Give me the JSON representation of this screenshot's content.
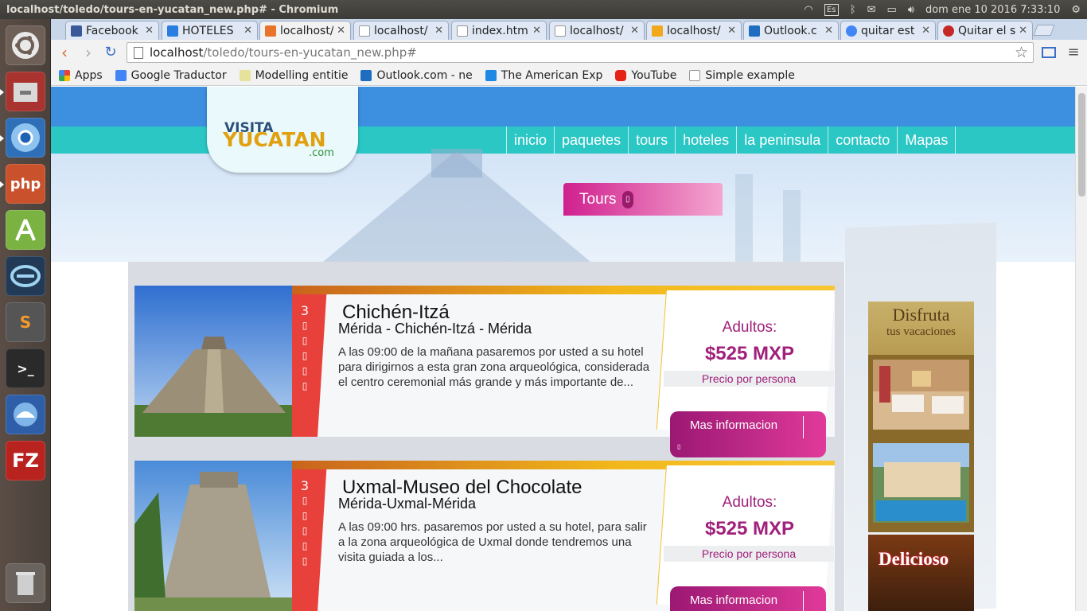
{
  "window": {
    "title": "localhost/toledo/tours-en-yucatan_new.php# - Chromium",
    "kbd_layout": "Es",
    "clock": "dom ene 10 2016  7:33:10"
  },
  "tabs": [
    {
      "label": "Facebook",
      "color": "#3b5998"
    },
    {
      "label": "HOTELES",
      "color": "#2a7de1"
    },
    {
      "label": "localhost/",
      "color": "#e8742c"
    },
    {
      "label": "localhost/",
      "color": "#bbbbbb"
    },
    {
      "label": "index.htm",
      "color": "#bbbbbb"
    },
    {
      "label": "localhost/",
      "color": "#bbbbbb"
    },
    {
      "label": "localhost/",
      "color": "#f2a81d"
    },
    {
      "label": "Outlook.c",
      "color": "#1f6dc0"
    },
    {
      "label": "quitar est",
      "color": "#4285f4"
    },
    {
      "label": "Quitar el s",
      "color": "#c62828"
    }
  ],
  "address": {
    "host": "localhost",
    "path": "/toledo/tours-en-yucatan_new.php#"
  },
  "bookmarks": [
    {
      "label": "Apps",
      "color": "#e94235"
    },
    {
      "label": "Google Traductor",
      "color": "#4285f4"
    },
    {
      "label": "Modelling entitie",
      "color": "#e7e29b"
    },
    {
      "label": "Outlook.com - ne",
      "color": "#1f6dc0"
    },
    {
      "label": "The American Exp",
      "color": "#1e88e5"
    },
    {
      "label": "YouTube",
      "color": "#e62117"
    },
    {
      "label": "Simple example",
      "color": "#dddddd"
    }
  ],
  "site": {
    "logo": {
      "line1": "VISITA",
      "line2": "YUCATAN",
      "line3": ".com"
    },
    "nav": [
      "inicio",
      "paquetes",
      "tours",
      "hoteles",
      "la peninsula",
      "contacto",
      "Mapas"
    ],
    "section_badge": "Tours",
    "badge_icon": "▯",
    "tours": [
      {
        "days": "3",
        "title": "Chichén-Itzá",
        "route": "Mérida - Chichén-Itzá - Mérida",
        "description": "A las 09:00 de la mañana pasaremos por usted a su hotel para dirigirnos a esta gran zona arqueológica, considerada el centro ceremonial más grande y más importante de...",
        "price_label": "Adultos:",
        "price": "$525 MXP",
        "per_person": "Precio por persona",
        "more": "Mas informacion"
      },
      {
        "days": "3",
        "title": "Uxmal-Museo del Chocolate",
        "route": "Mérida-Uxmal-Mérida",
        "description": "A las 09:00 hrs. pasaremos por usted a su hotel, para salir a la zona arqueológica de Uxmal donde tendremos una visita guiada a los...",
        "price_label": "Adultos:",
        "price": "$525 MXP",
        "per_person": "Precio por persona",
        "more": "Mas informacion"
      }
    ],
    "ads": {
      "top_title": "Disfruta",
      "top_sub": "tus vacaciones",
      "food": "Delicioso"
    }
  },
  "colors": {
    "accent_magenta": "#a0207a",
    "nav_teal": "#2ac7c5",
    "header_blue": "#3d8fe0",
    "days_red": "#e8403a"
  }
}
